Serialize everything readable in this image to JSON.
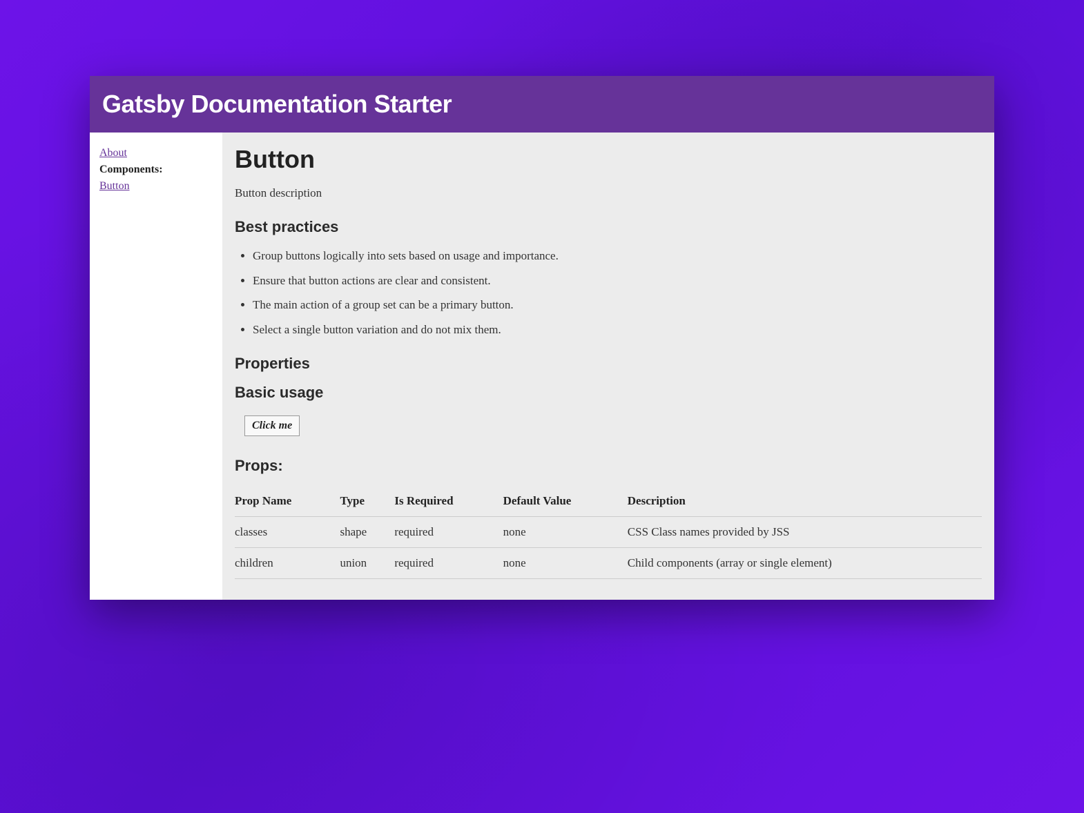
{
  "header": {
    "title": "Gatsby Documentation Starter"
  },
  "sidebar": {
    "about_link": "About",
    "components_label": "Components:",
    "items": [
      {
        "label": "Button"
      }
    ]
  },
  "main": {
    "title": "Button",
    "description": "Button description",
    "best_practices_heading": "Best practices",
    "best_practices": [
      "Group buttons logically into sets based on usage and importance.",
      "Ensure that button actions are clear and consistent.",
      "The main action of a group set can be a primary button.",
      "Select a single button variation and do not mix them."
    ],
    "properties_heading": "Properties",
    "basic_usage_heading": "Basic usage",
    "example_button_label": "Click me",
    "props_heading": "Props:",
    "props_table": {
      "headers": [
        "Prop Name",
        "Type",
        "Is Required",
        "Default Value",
        "Description"
      ],
      "rows": [
        {
          "name": "classes",
          "type": "shape",
          "required": "required",
          "default": "none",
          "description": "CSS Class names provided by JSS"
        },
        {
          "name": "children",
          "type": "union",
          "required": "required",
          "default": "none",
          "description": "Child components (array or single element)"
        }
      ]
    }
  }
}
